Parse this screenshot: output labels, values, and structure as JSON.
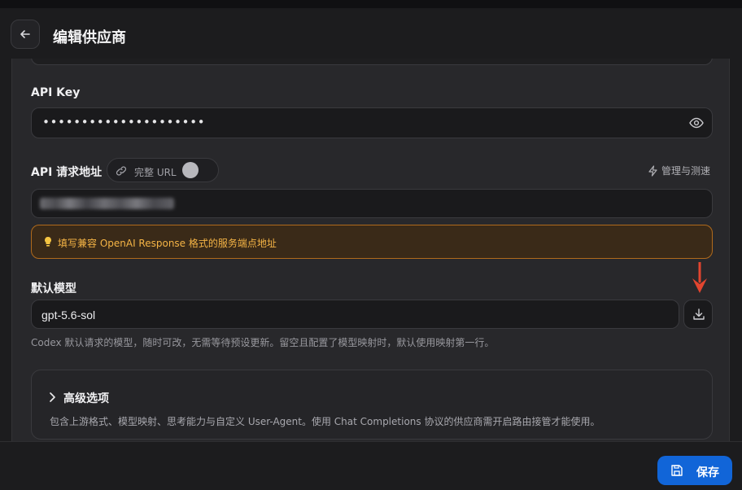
{
  "header": {
    "title": "编辑供应商"
  },
  "api_key": {
    "label": "API Key",
    "value": "•••••••••••••••••••••"
  },
  "api_url": {
    "label": "API 请求地址",
    "full_url_toggle_label": "完整 URL",
    "full_url_enabled": false,
    "manage_label": "管理与测速",
    "hint": "填写兼容 OpenAI Response 格式的服务端点地址"
  },
  "default_model": {
    "label": "默认模型",
    "value": "gpt-5.6-sol",
    "helper": "Codex 默认请求的模型，随时可改，无需等待预设更新。留空且配置了模型映射时，默认使用映射第一行。"
  },
  "advanced": {
    "title": "高级选项",
    "description": "包含上游格式、模型映射、思考能力与自定义 User-Agent。使用 Chat Completions 协议的供应商需开启路由接管才能使用。"
  },
  "footer": {
    "save_label": "保存"
  },
  "colors": {
    "accent": "#1165d8",
    "warning": "#f5b445",
    "arrow": "#e2452f"
  }
}
